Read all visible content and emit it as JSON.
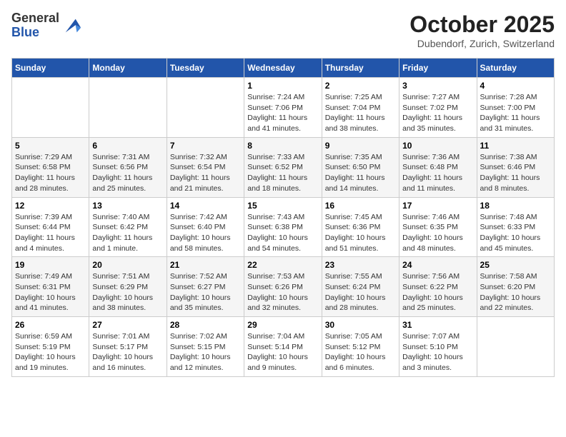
{
  "logo": {
    "general": "General",
    "blue": "Blue"
  },
  "title": "October 2025",
  "location": "Dubendorf, Zurich, Switzerland",
  "days_of_week": [
    "Sunday",
    "Monday",
    "Tuesday",
    "Wednesday",
    "Thursday",
    "Friday",
    "Saturday"
  ],
  "weeks": [
    [
      {
        "day": "",
        "info": ""
      },
      {
        "day": "",
        "info": ""
      },
      {
        "day": "",
        "info": ""
      },
      {
        "day": "1",
        "info": "Sunrise: 7:24 AM\nSunset: 7:06 PM\nDaylight: 11 hours and 41 minutes."
      },
      {
        "day": "2",
        "info": "Sunrise: 7:25 AM\nSunset: 7:04 PM\nDaylight: 11 hours and 38 minutes."
      },
      {
        "day": "3",
        "info": "Sunrise: 7:27 AM\nSunset: 7:02 PM\nDaylight: 11 hours and 35 minutes."
      },
      {
        "day": "4",
        "info": "Sunrise: 7:28 AM\nSunset: 7:00 PM\nDaylight: 11 hours and 31 minutes."
      }
    ],
    [
      {
        "day": "5",
        "info": "Sunrise: 7:29 AM\nSunset: 6:58 PM\nDaylight: 11 hours and 28 minutes."
      },
      {
        "day": "6",
        "info": "Sunrise: 7:31 AM\nSunset: 6:56 PM\nDaylight: 11 hours and 25 minutes."
      },
      {
        "day": "7",
        "info": "Sunrise: 7:32 AM\nSunset: 6:54 PM\nDaylight: 11 hours and 21 minutes."
      },
      {
        "day": "8",
        "info": "Sunrise: 7:33 AM\nSunset: 6:52 PM\nDaylight: 11 hours and 18 minutes."
      },
      {
        "day": "9",
        "info": "Sunrise: 7:35 AM\nSunset: 6:50 PM\nDaylight: 11 hours and 14 minutes."
      },
      {
        "day": "10",
        "info": "Sunrise: 7:36 AM\nSunset: 6:48 PM\nDaylight: 11 hours and 11 minutes."
      },
      {
        "day": "11",
        "info": "Sunrise: 7:38 AM\nSunset: 6:46 PM\nDaylight: 11 hours and 8 minutes."
      }
    ],
    [
      {
        "day": "12",
        "info": "Sunrise: 7:39 AM\nSunset: 6:44 PM\nDaylight: 11 hours and 4 minutes."
      },
      {
        "day": "13",
        "info": "Sunrise: 7:40 AM\nSunset: 6:42 PM\nDaylight: 11 hours and 1 minute."
      },
      {
        "day": "14",
        "info": "Sunrise: 7:42 AM\nSunset: 6:40 PM\nDaylight: 10 hours and 58 minutes."
      },
      {
        "day": "15",
        "info": "Sunrise: 7:43 AM\nSunset: 6:38 PM\nDaylight: 10 hours and 54 minutes."
      },
      {
        "day": "16",
        "info": "Sunrise: 7:45 AM\nSunset: 6:36 PM\nDaylight: 10 hours and 51 minutes."
      },
      {
        "day": "17",
        "info": "Sunrise: 7:46 AM\nSunset: 6:35 PM\nDaylight: 10 hours and 48 minutes."
      },
      {
        "day": "18",
        "info": "Sunrise: 7:48 AM\nSunset: 6:33 PM\nDaylight: 10 hours and 45 minutes."
      }
    ],
    [
      {
        "day": "19",
        "info": "Sunrise: 7:49 AM\nSunset: 6:31 PM\nDaylight: 10 hours and 41 minutes."
      },
      {
        "day": "20",
        "info": "Sunrise: 7:51 AM\nSunset: 6:29 PM\nDaylight: 10 hours and 38 minutes."
      },
      {
        "day": "21",
        "info": "Sunrise: 7:52 AM\nSunset: 6:27 PM\nDaylight: 10 hours and 35 minutes."
      },
      {
        "day": "22",
        "info": "Sunrise: 7:53 AM\nSunset: 6:26 PM\nDaylight: 10 hours and 32 minutes."
      },
      {
        "day": "23",
        "info": "Sunrise: 7:55 AM\nSunset: 6:24 PM\nDaylight: 10 hours and 28 minutes."
      },
      {
        "day": "24",
        "info": "Sunrise: 7:56 AM\nSunset: 6:22 PM\nDaylight: 10 hours and 25 minutes."
      },
      {
        "day": "25",
        "info": "Sunrise: 7:58 AM\nSunset: 6:20 PM\nDaylight: 10 hours and 22 minutes."
      }
    ],
    [
      {
        "day": "26",
        "info": "Sunrise: 6:59 AM\nSunset: 5:19 PM\nDaylight: 10 hours and 19 minutes."
      },
      {
        "day": "27",
        "info": "Sunrise: 7:01 AM\nSunset: 5:17 PM\nDaylight: 10 hours and 16 minutes."
      },
      {
        "day": "28",
        "info": "Sunrise: 7:02 AM\nSunset: 5:15 PM\nDaylight: 10 hours and 12 minutes."
      },
      {
        "day": "29",
        "info": "Sunrise: 7:04 AM\nSunset: 5:14 PM\nDaylight: 10 hours and 9 minutes."
      },
      {
        "day": "30",
        "info": "Sunrise: 7:05 AM\nSunset: 5:12 PM\nDaylight: 10 hours and 6 minutes."
      },
      {
        "day": "31",
        "info": "Sunrise: 7:07 AM\nSunset: 5:10 PM\nDaylight: 10 hours and 3 minutes."
      },
      {
        "day": "",
        "info": ""
      }
    ]
  ]
}
